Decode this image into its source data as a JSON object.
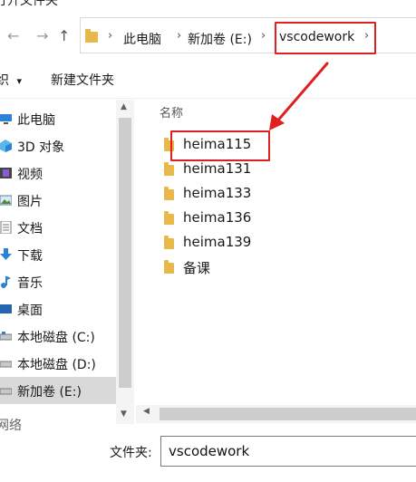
{
  "window": {
    "title": "打开文件夹"
  },
  "nav": {
    "back": "←",
    "forward": "→",
    "recent": "⌄",
    "up": "↑"
  },
  "breadcrumb": {
    "items": [
      "此电脑",
      "新加卷 (E:)",
      "vscodework"
    ],
    "separator": "›",
    "expand": "›"
  },
  "toolbar": {
    "organize_label": "织",
    "organize_arrow": "▾",
    "new_folder_label": "新建文件夹"
  },
  "sidebar": {
    "items": [
      {
        "label": "此电脑",
        "icon": "computer-icon"
      },
      {
        "label": "3D 对象",
        "icon": "cube-icon"
      },
      {
        "label": "视频",
        "icon": "video-icon"
      },
      {
        "label": "图片",
        "icon": "picture-icon"
      },
      {
        "label": "文档",
        "icon": "document-icon"
      },
      {
        "label": "下载",
        "icon": "download-icon"
      },
      {
        "label": "音乐",
        "icon": "music-icon"
      },
      {
        "label": "桌面",
        "icon": "desktop-icon"
      },
      {
        "label": "本地磁盘 (C:)",
        "icon": "drive-icon"
      },
      {
        "label": "本地磁盘 (D:)",
        "icon": "drive-icon"
      },
      {
        "label": "新加卷 (E:)",
        "icon": "drive-icon",
        "selected": true
      }
    ],
    "partial_item": "网络"
  },
  "content": {
    "column_header": "名称",
    "files": [
      "heima115",
      "heima131",
      "heima133",
      "heima136",
      "heima139",
      "备课"
    ]
  },
  "footer": {
    "folder_label": "文件夹:",
    "folder_value": "vscodework"
  },
  "colors": {
    "highlight": "#e02020",
    "folder": "#e8b84a",
    "selection": "#d9d9d9"
  }
}
